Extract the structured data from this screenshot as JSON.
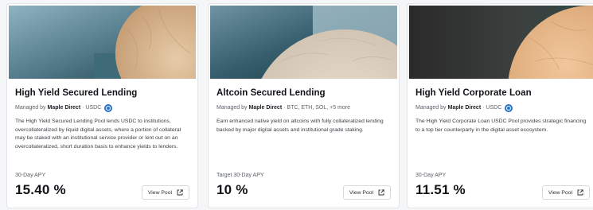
{
  "cards": [
    {
      "title": "High Yield Secured Lending",
      "managed_prefix": "Managed by",
      "manager": "Maple Direct",
      "assets": "· USDC",
      "asset_icon": "usdc-icon",
      "description": "The High Yield Secured Lending Pool lends USDC to institutions, overcollateralized by liquid digital assets, where a portion of collateral may be staked with an institutional service provider or lent out on an overcollateralized, short duration basis to enhance yields to lenders.",
      "apy_label": "30-Day APY",
      "apy_value": "15.40 %",
      "button_label": "View Pool"
    },
    {
      "title": "Altcoin Secured Lending",
      "managed_prefix": "Managed by",
      "manager": "Maple Direct",
      "assets": "· BTC, ETH, SOL, +5 more",
      "description": "Earn enhanced native yield on altcoins with fully collateralized lending backed by major digital assets and institutional grade staking.",
      "apy_label": "Target 30-Day APY",
      "apy_value": "10 %",
      "button_label": "View Pool"
    },
    {
      "title": "High Yield Corporate Loan",
      "managed_prefix": "Managed by",
      "manager": "Maple Direct",
      "assets": "· USDC",
      "asset_icon": "usdc-icon",
      "description": "The High Yield Corporate Loan USDC Pool provides strategic financing to a top tier counterparty in the digital asset ecosystem.",
      "apy_label": "30-Day APY",
      "apy_value": "11.51 %",
      "button_label": "View Pool"
    }
  ],
  "colors": {
    "usdc": "#2775ca",
    "marble": "#d9b892",
    "teal_dark": "#2f5563",
    "teal_light": "#8fb2c0"
  },
  "icons": {
    "view_pool": "external-link-icon"
  }
}
